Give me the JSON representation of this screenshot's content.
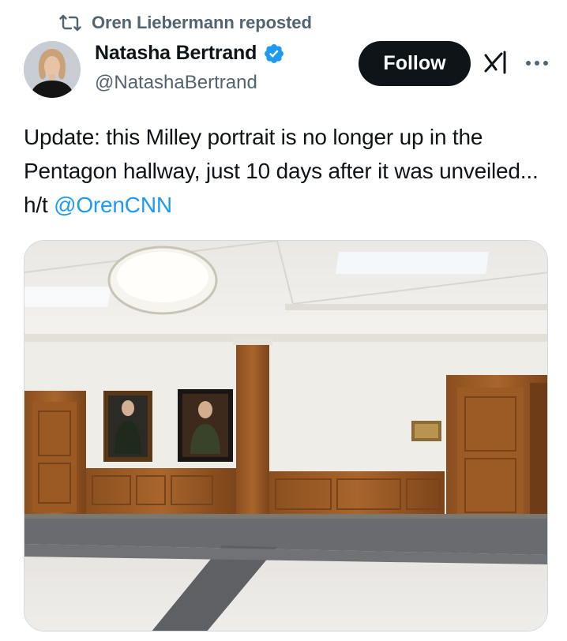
{
  "repost": {
    "icon": "repost-icon",
    "label": "Oren Liebermann reposted"
  },
  "author": {
    "display_name": "Natasha Bertrand",
    "handle": "@NatashaBertrand",
    "verified": true,
    "verified_color": "#1d9bf0"
  },
  "actions": {
    "follow_label": "Follow",
    "grok_icon": "grok-icon",
    "more_icon": "more-icon"
  },
  "tweet": {
    "text_before": "Update: this Milley portrait is no longer up in the Pentagon hallway, just 10 days after it was unveiled... h/t ",
    "mention": "@OrenCNN",
    "mention_color": "#1d9bf0"
  },
  "colors": {
    "text_primary": "#0f1419",
    "text_secondary": "#536471",
    "follow_bg": "#0f1419"
  }
}
